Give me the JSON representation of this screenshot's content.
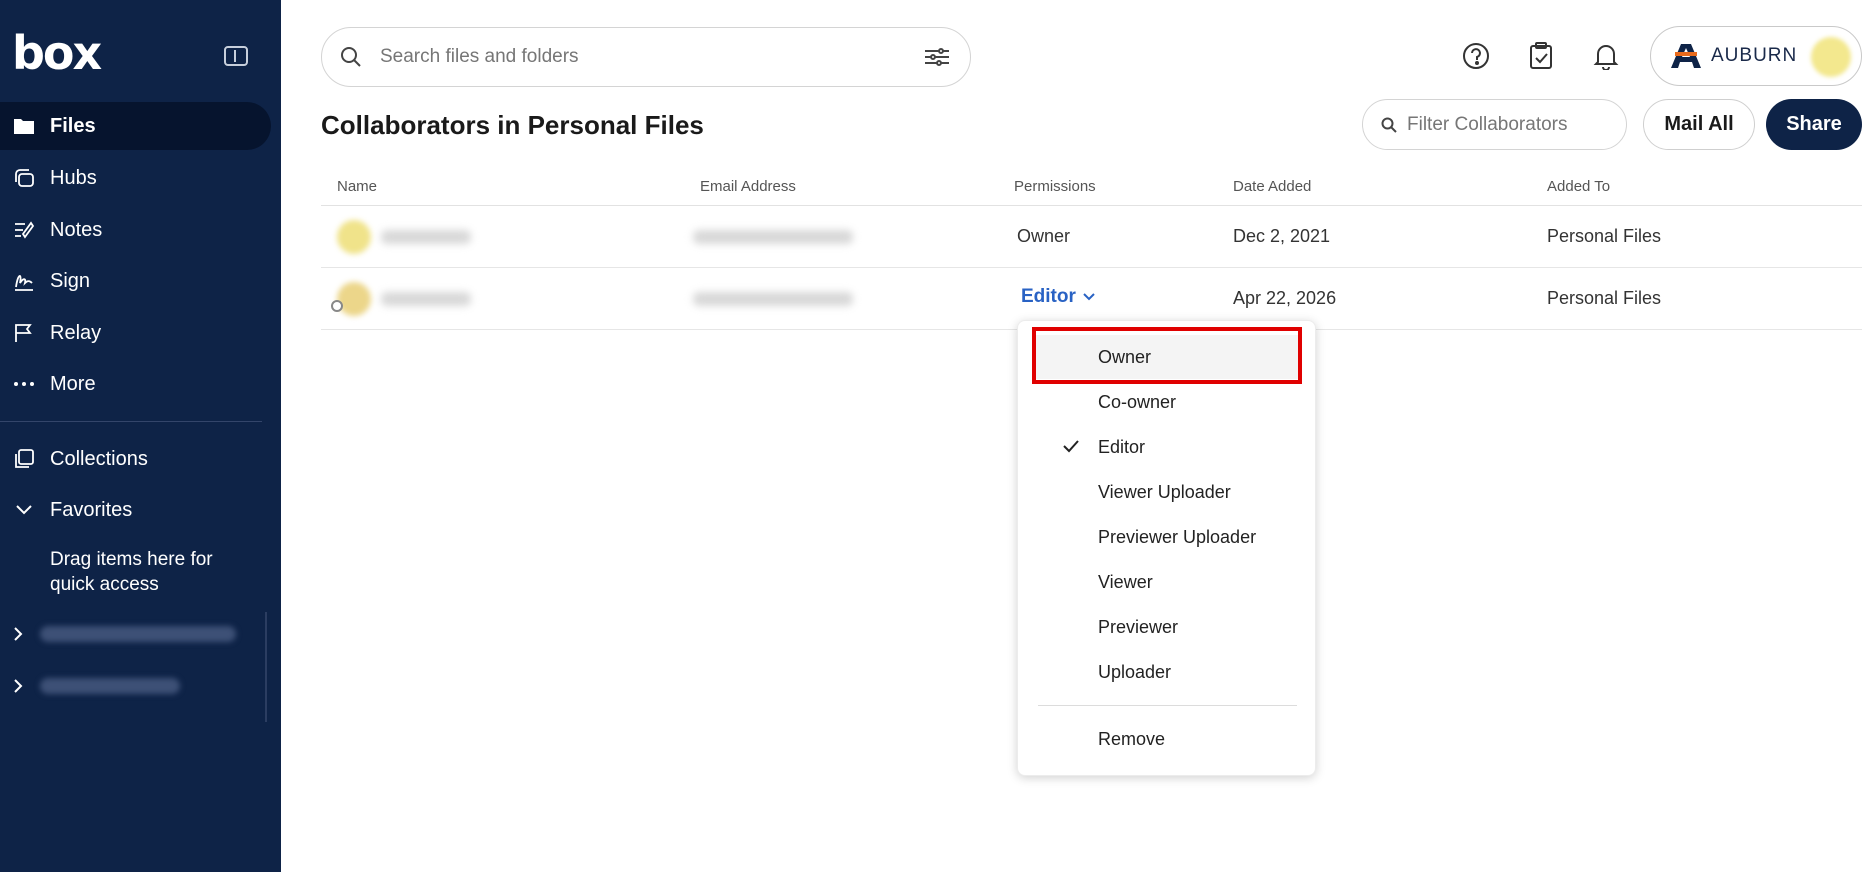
{
  "sidebar": {
    "logo": "box",
    "nav": [
      {
        "label": "Files",
        "icon": "folder-icon",
        "active": true
      },
      {
        "label": "Hubs",
        "icon": "hubs-icon"
      },
      {
        "label": "Notes",
        "icon": "notes-icon"
      },
      {
        "label": "Sign",
        "icon": "sign-icon"
      },
      {
        "label": "Relay",
        "icon": "relay-icon"
      },
      {
        "label": "More",
        "icon": "more-icon"
      }
    ],
    "collections_label": "Collections",
    "favorites_label": "Favorites",
    "drag_text": "Drag items here for quick access"
  },
  "header": {
    "search_placeholder": "Search files and folders",
    "account_name": "AUBURN"
  },
  "page": {
    "title": "Collaborators in Personal Files",
    "filter_placeholder": "Filter Collaborators",
    "mail_all_label": "Mail All",
    "share_label": "Share"
  },
  "table": {
    "columns": [
      "Name",
      "Email Address",
      "Permissions",
      "Date Added",
      "Added To"
    ],
    "rows": [
      {
        "permission": "Owner",
        "date_added": "Dec 2, 2021",
        "added_to": "Personal Files"
      },
      {
        "permission": "Editor",
        "date_added": "Apr 22, 2026",
        "added_to": "Personal Files"
      }
    ]
  },
  "permission_menu": {
    "items": [
      "Owner",
      "Co-owner",
      "Editor",
      "Viewer Uploader",
      "Previewer Uploader",
      "Viewer",
      "Previewer",
      "Uploader"
    ],
    "selected": "Editor",
    "remove_label": "Remove"
  },
  "colors": {
    "sidebar_bg": "#0e2347",
    "accent_blue": "#2962c4",
    "highlight_red": "#e00000"
  }
}
